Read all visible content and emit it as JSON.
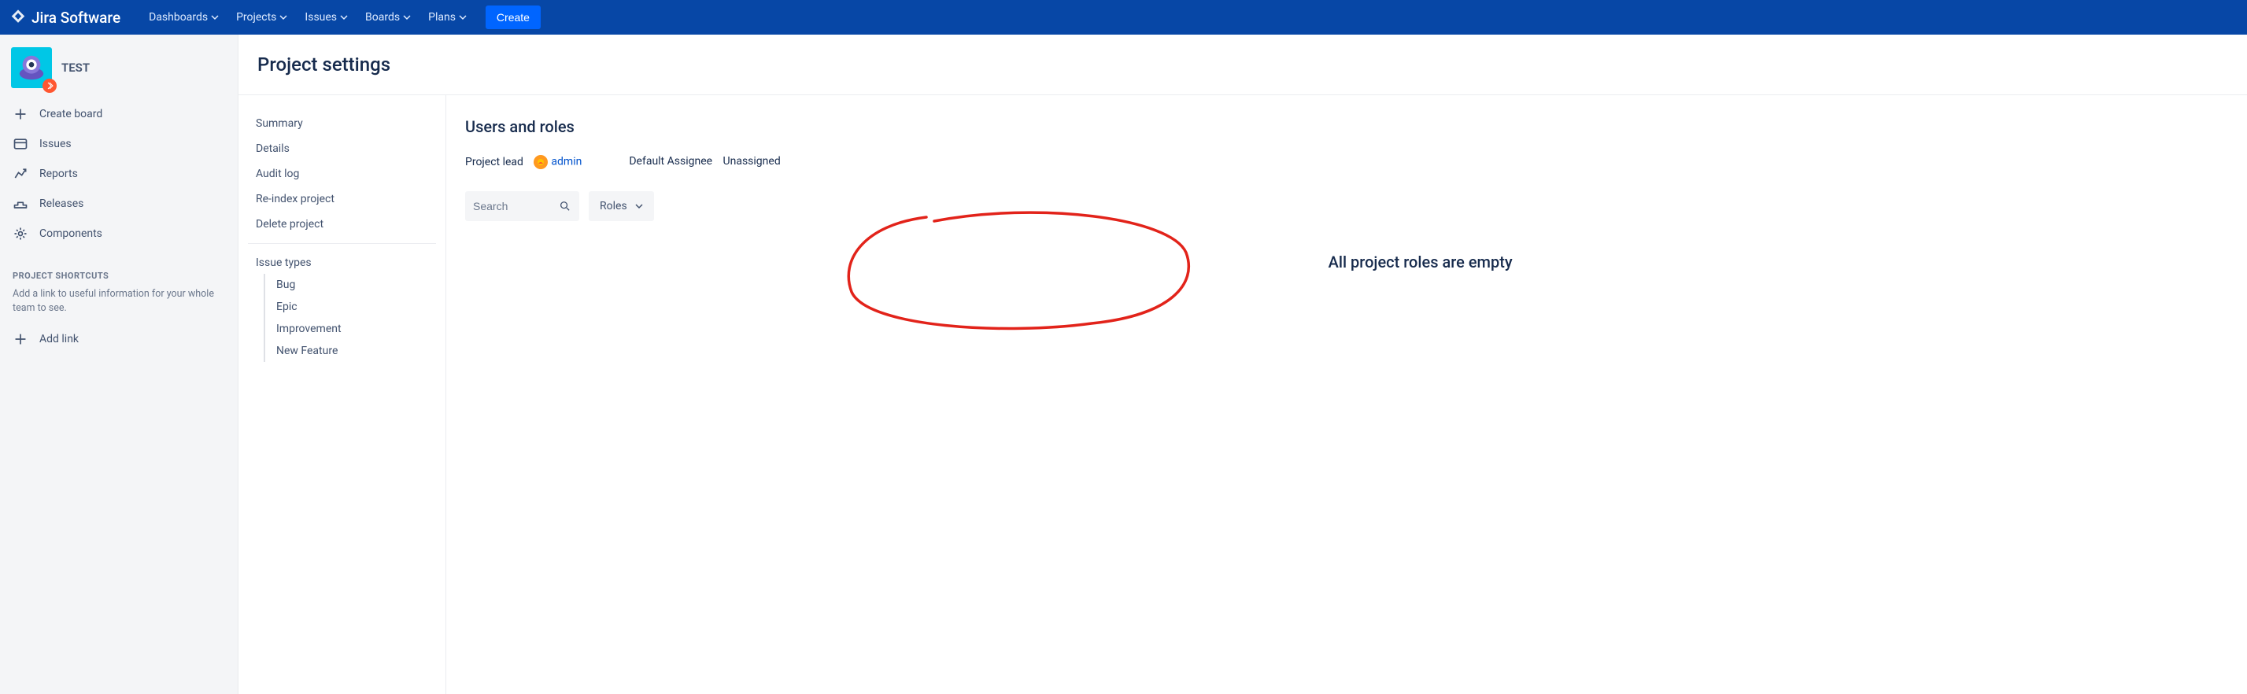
{
  "topnav": {
    "product": "Jira Software",
    "items": [
      "Dashboards",
      "Projects",
      "Issues",
      "Boards",
      "Plans"
    ],
    "create": "Create"
  },
  "sidebar": {
    "project_name": "TEST",
    "items": [
      {
        "label": "Create board",
        "icon": "plus"
      },
      {
        "label": "Issues",
        "icon": "issues"
      },
      {
        "label": "Reports",
        "icon": "reports"
      },
      {
        "label": "Releases",
        "icon": "releases"
      },
      {
        "label": "Components",
        "icon": "components"
      }
    ],
    "shortcuts_header": "PROJECT SHORTCUTS",
    "shortcuts_help": "Add a link to useful information for your whole team to see.",
    "add_link": "Add link"
  },
  "page": {
    "title": "Project settings"
  },
  "settings_nav": {
    "items": [
      "Summary",
      "Details",
      "Audit log",
      "Re-index project",
      "Delete project"
    ],
    "issue_types_header": "Issue types",
    "issue_types": [
      "Bug",
      "Epic",
      "Improvement",
      "New Feature"
    ]
  },
  "content": {
    "heading": "Users and roles",
    "project_lead_label": "Project lead",
    "project_lead_value": "admin",
    "default_assignee_label": "Default Assignee",
    "default_assignee_value": "Unassigned",
    "search_placeholder": "Search",
    "roles_label": "Roles",
    "empty_message": "All project roles are empty"
  }
}
